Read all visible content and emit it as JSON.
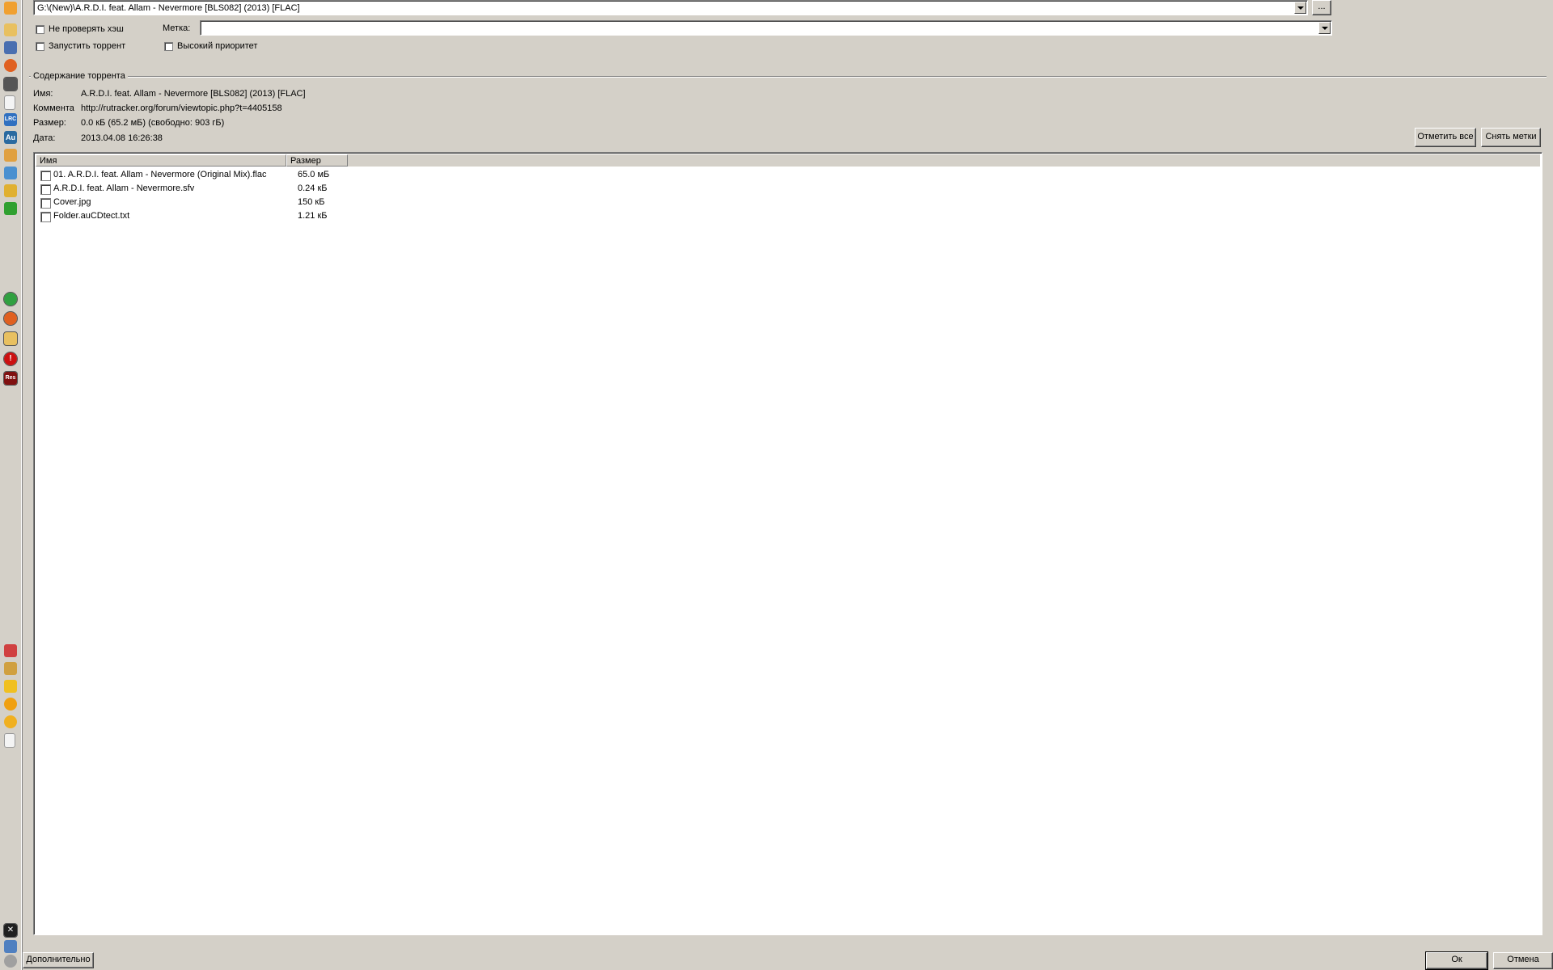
{
  "path": {
    "value": "G:\\(New)\\A.R.D.I. feat. Allam - Nevermore [BLS082] (2013) [FLAC]",
    "browse_label": "..."
  },
  "options": {
    "skip_hash_label": "Не проверять хэш",
    "start_torrent_label": "Запустить торрент",
    "label_caption": "Метка:",
    "label_value": "",
    "high_priority_label": "Высокий приоритет"
  },
  "group": {
    "title": "Содержание торрента"
  },
  "info": {
    "name_key": "Имя:",
    "name_value": "A.R.D.I. feat. Allam - Nevermore [BLS082] (2013) [FLAC]",
    "comment_key": "Коммента",
    "comment_value": "http://rutracker.org/forum/viewtopic.php?t=4405158",
    "size_key": "Размер:",
    "size_value": "0.0 кБ (65.2 мБ) (свободно: 903 гБ)",
    "date_key": "Дата:",
    "date_value": "2013.04.08 16:26:38"
  },
  "buttons": {
    "mark_all": "Отметить все",
    "unmark": "Снять метки",
    "more": "Дополнительно",
    "ok": "Ок",
    "cancel": "Отмена"
  },
  "file_list": {
    "columns": [
      "Имя",
      "Размер"
    ],
    "rows": [
      {
        "name": "01. A.R.D.I. feat. Allam - Nevermore (Original Mix).flac",
        "size": "65.0 мБ",
        "checked": false
      },
      {
        "name": "A.R.D.I. feat. Allam - Nevermore.sfv",
        "size": "0.24 кБ",
        "checked": false
      },
      {
        "name": "Cover.jpg",
        "size": "150 кБ",
        "checked": false
      },
      {
        "name": "Folder.auCDtect.txt",
        "size": "1.21 кБ",
        "checked": false
      }
    ]
  },
  "quickbar": {
    "icons": [
      "windows-flag-icon",
      "folder-open-icon",
      "media-icon",
      "firefox-icon",
      "download-icon",
      "document-icon",
      "lrc-icon",
      "audition-icon",
      "tools-icon",
      "network-icon",
      "star-folder-icon",
      "color-palette-icon",
      "utorrent-icon",
      "firefox-icon",
      "explorer-icon",
      "stop-icon",
      "resource-icon",
      "cubes-icon",
      "settings-icon",
      "favorite-icon",
      "sun-icon",
      "globe-icon",
      "notes-icon",
      "x-app-icon",
      "recycle-icon"
    ]
  },
  "colors": {
    "face": "#d4d0c8",
    "shadow": "#808080",
    "window": "#ffffff"
  }
}
